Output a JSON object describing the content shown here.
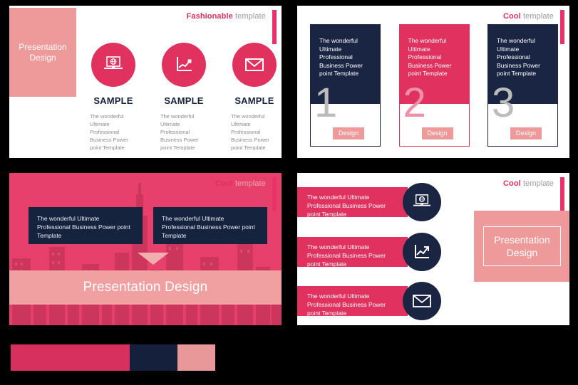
{
  "colors": {
    "crimson": "#dd2f5f",
    "pink": "#e0315f",
    "navy": "#16233f",
    "navy_soft": "#1a2544",
    "salmon": "#ef9a9a",
    "grey_text": "#8c8c8c",
    "grey_number": "#bcbcbc"
  },
  "slide1": {
    "header": {
      "strong": "Fashionable",
      "light": "template"
    },
    "panel_title": "Presentation\nDesign",
    "panel_title_line1": "Presentation",
    "panel_title_line2": "Design",
    "columns": [
      {
        "icon": "laptop-globe-icon",
        "title": "SAMPLE",
        "desc": "The wonderful Ultimate Professional Business Power point Template"
      },
      {
        "icon": "growth-chart-icon",
        "title": "SAMPLE",
        "desc": "The wonderful Ultimate Professional Business Power point Template"
      },
      {
        "icon": "envelope-icon",
        "title": "SAMPLE",
        "desc": "The wonderful Ultimate Professional Business Power point Template"
      }
    ]
  },
  "slide2": {
    "header": {
      "strong": "Cool",
      "light": "template"
    },
    "cards": [
      {
        "style": "dark",
        "body": "The wonderful Ultimate Professional Business Power point Template",
        "number": "1",
        "button": "Design"
      },
      {
        "style": "pink",
        "body": "The wonderful Ultimate Professional Business Power point Template",
        "number": "2",
        "button": "Design"
      },
      {
        "style": "dark",
        "body": "The wonderful Ultimate Professional Business Power point Template",
        "number": "3",
        "button": "Design"
      }
    ]
  },
  "slide3": {
    "header": {
      "strong": "Cool",
      "light": "template"
    },
    "boxes": [
      "The wonderful Ultimate Professional Business Power point Template",
      "The wonderful Ultimate Professional Business Power point Template"
    ],
    "arrow": "down-triangle-icon",
    "band_text": "Presentation Design"
  },
  "slide4": {
    "header": {
      "strong": "Cool",
      "light": "template"
    },
    "rows": [
      {
        "text": "The wonderful Ultimate Professional Business Power point Template",
        "icon": "laptop-globe-icon"
      },
      {
        "text": "The wonderful Ultimate Professional Business Power point Template",
        "icon": "growth-chart-icon"
      },
      {
        "text": "The wonderful Ultimate Professional Business Power point Template",
        "icon": "envelope-icon"
      }
    ],
    "panel_line1": "Presentation",
    "panel_line2": "Design"
  },
  "swatches": [
    {
      "name": "swatch-crimson",
      "color": "#d7305e"
    },
    {
      "name": "swatch-navy",
      "color": "#14203c"
    },
    {
      "name": "swatch-salmon",
      "color": "#e89898"
    }
  ]
}
